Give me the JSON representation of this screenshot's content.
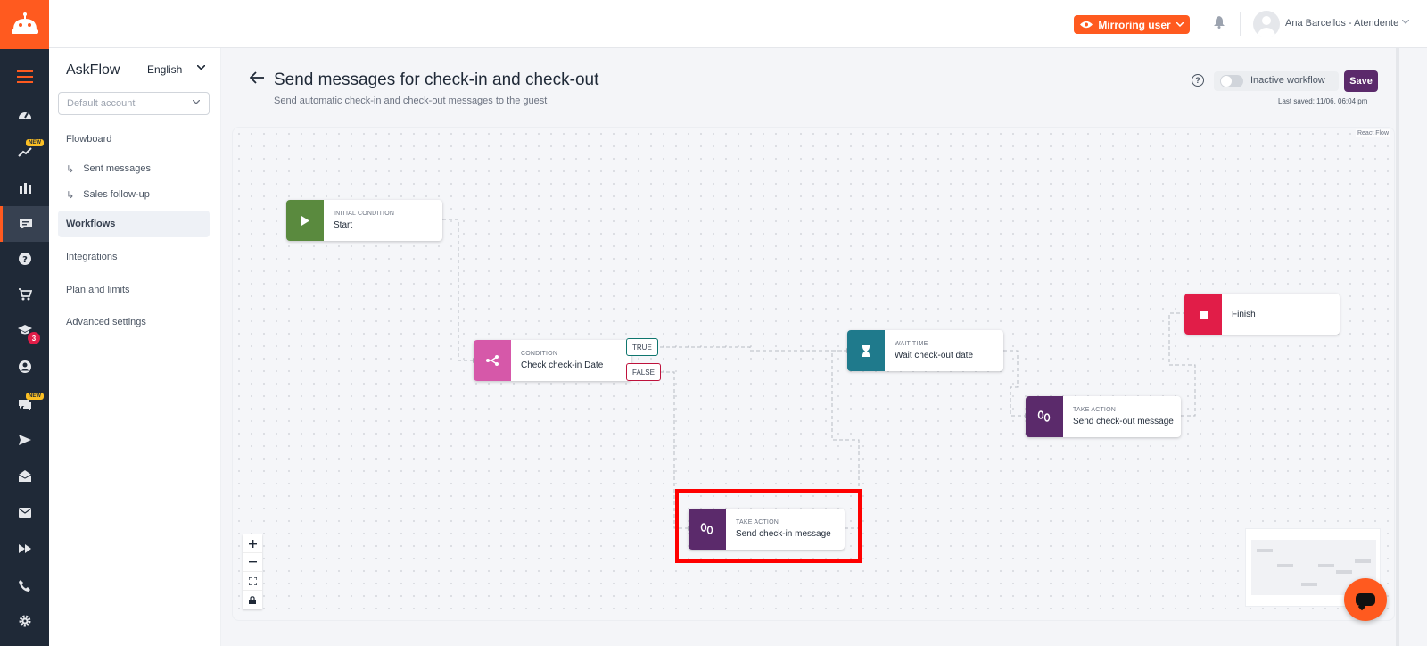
{
  "topbar": {
    "mirror_label": "Mirroring user",
    "user_name": "Ana Barcellos - Atendente"
  },
  "sidebar": {
    "brand": "AskFlow",
    "language": "English",
    "account_placeholder": "Default account",
    "items": [
      {
        "label": "Flowboard"
      },
      {
        "label": "Sent messages"
      },
      {
        "label": "Sales follow-up"
      },
      {
        "label": "Workflows"
      },
      {
        "label": "Integrations"
      },
      {
        "label": "Plan and limits"
      },
      {
        "label": "Advanced settings"
      }
    ]
  },
  "rail": {
    "new_badge": "NEW",
    "count_badge": "3"
  },
  "header": {
    "title": "Send messages for check-in and check-out",
    "subtitle": "Send automatic check-in and check-out messages to the guest",
    "toggle_label": "Inactive workflow",
    "save_label": "Save",
    "last_saved": "Last saved: 11/06, 06:04 pm"
  },
  "canvas": {
    "attribution": "React Flow",
    "nodes": [
      {
        "type": "INITIAL CONDITION",
        "label": "Start",
        "color": "#5a8a3e"
      },
      {
        "type": "CONDITION",
        "label": "Check check-in Date",
        "color": "#d658a9"
      },
      {
        "type": "WAIT TIME",
        "label": "Wait check-out date",
        "color": "#1f7a8c"
      },
      {
        "type": "TAKE ACTION",
        "label": "Send check-out message",
        "color": "#5b2a6b"
      },
      {
        "type": "TAKE ACTION",
        "label": "Send check-in message",
        "color": "#5b2a6b"
      },
      {
        "type": "",
        "label": "Finish",
        "color": "#e11d48"
      }
    ],
    "true_label": "TRUE",
    "false_label": "FALSE"
  },
  "colors": {
    "accent": "#ff5a1f",
    "rail_bg": "#1f2937",
    "save": "#5b2a6b",
    "highlight": "#ff0000"
  }
}
